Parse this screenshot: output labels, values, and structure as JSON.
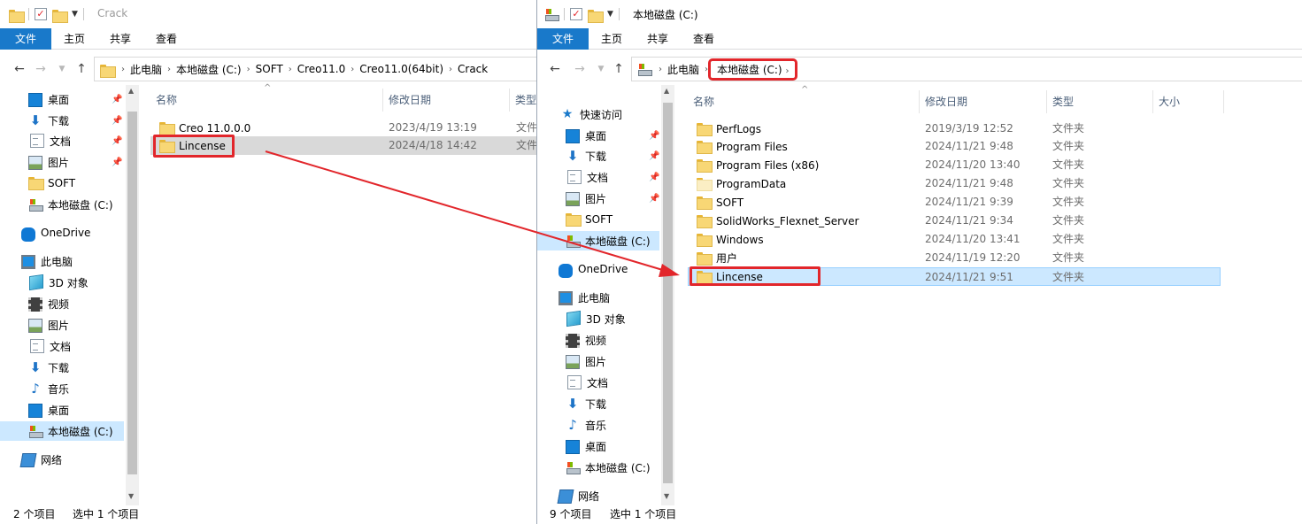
{
  "left": {
    "title": "Crack",
    "ribbon": [
      "文件",
      "主页",
      "共享",
      "查看"
    ],
    "breadcrumb": [
      "此电脑",
      "本地磁盘 (C:)",
      "SOFT",
      "Creo11.0",
      "Creo11.0(64bit)",
      "Crack"
    ],
    "nav": [
      {
        "label": "桌面",
        "icon": "desktop-icon",
        "pin": true
      },
      {
        "label": "下载",
        "icon": "download-icon",
        "pin": true
      },
      {
        "label": "文档",
        "icon": "document-icon",
        "pin": true
      },
      {
        "label": "图片",
        "icon": "pictures-icon",
        "pin": true
      },
      {
        "label": "SOFT",
        "icon": "folder-icon"
      },
      {
        "label": "本地磁盘 (C:)",
        "icon": "drive-icon"
      },
      {
        "label": "OneDrive",
        "icon": "onedrive-icon"
      },
      {
        "label": "此电脑",
        "icon": "this-pc-icon"
      },
      {
        "label": "3D 对象",
        "icon": "3d-objects-icon"
      },
      {
        "label": "视频",
        "icon": "videos-icon"
      },
      {
        "label": "图片",
        "icon": "pictures-icon"
      },
      {
        "label": "文档",
        "icon": "document-icon"
      },
      {
        "label": "下载",
        "icon": "download-icon"
      },
      {
        "label": "音乐",
        "icon": "music-icon"
      },
      {
        "label": "桌面",
        "icon": "desktop-icon"
      },
      {
        "label": "本地磁盘 (C:)",
        "icon": "drive-icon",
        "selected": true
      },
      {
        "label": "网络",
        "icon": "network-icon"
      }
    ],
    "columns": [
      "名称",
      "修改日期",
      "类型"
    ],
    "files": [
      {
        "name": "Creo 11.0.0.0",
        "date": "2023/4/19 13:19",
        "type": "文件"
      },
      {
        "name": "Lincense",
        "date": "2024/4/18 14:42",
        "type": "文件"
      }
    ],
    "status": {
      "count": "2 个项目",
      "selected": "选中 1 个项目"
    }
  },
  "right": {
    "title": "本地磁盘 (C:)",
    "ribbon": [
      "文件",
      "主页",
      "共享",
      "查看"
    ],
    "breadcrumb": [
      "此电脑",
      "本地磁盘 (C:)"
    ],
    "nav": [
      {
        "label": "快速访问",
        "icon": "quick-access-star-icon"
      },
      {
        "label": "桌面",
        "icon": "desktop-icon",
        "pin": true
      },
      {
        "label": "下载",
        "icon": "download-icon",
        "pin": true
      },
      {
        "label": "文档",
        "icon": "document-icon",
        "pin": true
      },
      {
        "label": "图片",
        "icon": "pictures-icon",
        "pin": true
      },
      {
        "label": "SOFT",
        "icon": "folder-icon"
      },
      {
        "label": "本地磁盘 (C:)",
        "icon": "drive-icon",
        "selected": true
      },
      {
        "label": "OneDrive",
        "icon": "onedrive-icon"
      },
      {
        "label": "此电脑",
        "icon": "this-pc-icon"
      },
      {
        "label": "3D 对象",
        "icon": "3d-objects-icon"
      },
      {
        "label": "视频",
        "icon": "videos-icon"
      },
      {
        "label": "图片",
        "icon": "pictures-icon"
      },
      {
        "label": "文档",
        "icon": "document-icon"
      },
      {
        "label": "下载",
        "icon": "download-icon"
      },
      {
        "label": "音乐",
        "icon": "music-icon"
      },
      {
        "label": "桌面",
        "icon": "desktop-icon"
      },
      {
        "label": "本地磁盘 (C:)",
        "icon": "drive-icon"
      },
      {
        "label": "网络",
        "icon": "network-icon"
      }
    ],
    "columns": [
      "名称",
      "修改日期",
      "类型",
      "大小"
    ],
    "files": [
      {
        "name": "PerfLogs",
        "date": "2019/3/19 12:52",
        "type": "文件夹"
      },
      {
        "name": "Program Files",
        "date": "2024/11/21 9:48",
        "type": "文件夹"
      },
      {
        "name": "Program Files (x86)",
        "date": "2024/11/20 13:40",
        "type": "文件夹"
      },
      {
        "name": "ProgramData",
        "date": "2024/11/21 9:48",
        "type": "文件夹"
      },
      {
        "name": "SOFT",
        "date": "2024/11/21 9:39",
        "type": "文件夹"
      },
      {
        "name": "SolidWorks_Flexnet_Server",
        "date": "2024/11/21 9:34",
        "type": "文件夹"
      },
      {
        "name": "Windows",
        "date": "2024/11/20 13:41",
        "type": "文件夹"
      },
      {
        "name": "用户",
        "date": "2024/11/19 12:20",
        "type": "文件夹"
      },
      {
        "name": "Lincense",
        "date": "2024/11/21 9:51",
        "type": "文件夹"
      }
    ],
    "status": {
      "count": "9 个项目",
      "selected": "选中 1 个项目"
    }
  },
  "colors": {
    "accent": "#1979ca",
    "highlight": "#e2262b",
    "selection": "#cce8ff"
  }
}
